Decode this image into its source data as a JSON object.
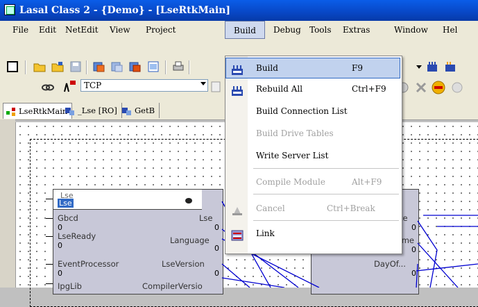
{
  "window": {
    "title": "Lasal Class 2 - {Demo} - [LseRtkMain]"
  },
  "menubar": {
    "items": [
      {
        "label": "File"
      },
      {
        "label": "Edit"
      },
      {
        "label": "NetEdit"
      },
      {
        "label": "View"
      },
      {
        "label": "Project"
      },
      {
        "label": "Build"
      },
      {
        "label": "Debug"
      },
      {
        "label": "Tools"
      },
      {
        "label": "Extras"
      },
      {
        "label": "Window"
      },
      {
        "label": "Hel"
      }
    ]
  },
  "toolbar2": {
    "connection_value": "TCP"
  },
  "tabs": [
    {
      "label": "LseRtkMain"
    },
    {
      "label": "_Lse [RO]"
    },
    {
      "label": "GetB"
    }
  ],
  "build_menu": {
    "items": [
      {
        "label": "Build",
        "shortcut": "F9",
        "enabled": true,
        "highlighted": true,
        "icon": "build-icon"
      },
      {
        "label": "Rebuild All",
        "shortcut": "Ctrl+F9",
        "enabled": true,
        "icon": "rebuild-icon"
      },
      {
        "label": "Build Connection List",
        "shortcut": "",
        "enabled": true
      },
      {
        "label": "Build Drive Tables",
        "shortcut": "",
        "enabled": false
      },
      {
        "label": "Write Server List",
        "shortcut": "",
        "enabled": true
      },
      {
        "label": "Compile Module",
        "shortcut": "Alt+F9",
        "enabled": false
      },
      {
        "label": "Cancel",
        "shortcut": "Ctrl+Break",
        "enabled": false,
        "icon": "cancel-icon"
      },
      {
        "label": "Link",
        "shortcut": "",
        "enabled": true,
        "icon": "link-icon"
      }
    ]
  },
  "module_lse": {
    "class_name": "Lse",
    "instance_name": "Lse",
    "ports": [
      {
        "left": "Gbcd",
        "right": "Lse",
        "left_val": "0",
        "right_val": "0"
      },
      {
        "left": "LseReady",
        "right": "Language",
        "left_val": "0",
        "right_val": "0"
      },
      {
        "left": "EventProcessor",
        "right": "LseVersion",
        "left_val": "0",
        "right_val": "0"
      },
      {
        "left": "IpgLib",
        "right": "CompilerVersio",
        "left_val": "",
        "right_val": ""
      }
    ]
  },
  "module_right": {
    "ports": [
      {
        "right": "ate",
        "val": "0"
      },
      {
        "left": "0",
        "right": "time",
        "val": "0"
      },
      {
        "right": "DayOf...",
        "val": "0"
      }
    ]
  }
}
